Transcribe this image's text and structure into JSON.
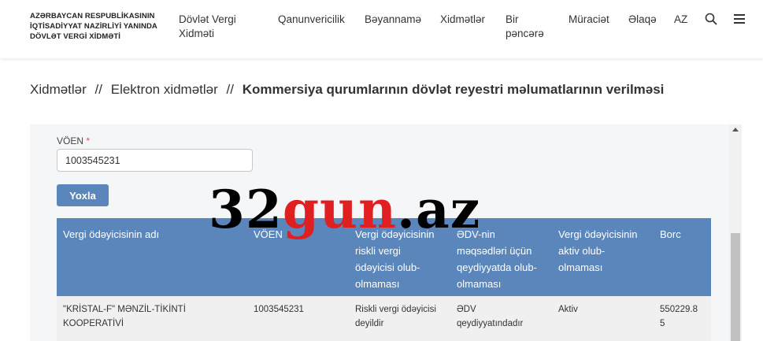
{
  "header": {
    "logo_lines": [
      "AZƏRBAYCAN RESPUBLİKASININ",
      "İQTİSADİYYAT NAZİRLİYİ YANINDA",
      "DÖVLƏT VERGİ XİDMƏTİ"
    ],
    "nav": [
      {
        "label_line1": "Dövlət Vergi",
        "label_line2": "Xidməti"
      },
      {
        "label_line1": "Qanunvericilik"
      },
      {
        "label_line1": "Bəyannamə"
      },
      {
        "label_line1": "Xidmətlər"
      },
      {
        "label_line1": "Bir",
        "label_line2": "pəncərə"
      },
      {
        "label_line1": "Müraciət"
      },
      {
        "label_line1": "Əlaqə"
      },
      {
        "label_line1": "AZ"
      }
    ]
  },
  "breadcrumb": {
    "items": [
      "Xidmətlər",
      "Elektron xidmətlər"
    ],
    "separator": "//",
    "current": "Kommersiya qurumlarının dövlət reyestri məlumatlarının verilməsi"
  },
  "form": {
    "voen_label": "VÖEN",
    "required_mark": "*",
    "voen_value": "1003545231",
    "check_button": "Yoxla"
  },
  "table": {
    "headers": [
      {
        "l1": "Vergi ödəyicisinin adı"
      },
      {
        "l1": "VÖEN"
      },
      {
        "l1": "Vergi ödəyicisinin",
        "l2": "riskli vergi",
        "l3": "ödəyicisi olub-",
        "l4": "olmaması"
      },
      {
        "l1": "ƏDV-nin",
        "l2": "məqsədləri üçün",
        "l3": "qeydiyyatda olub-",
        "l4": "olmaması"
      },
      {
        "l1": "Vergi ödəyicisinin",
        "l2": "aktiv olub-",
        "l3": "olmaması"
      },
      {
        "l1": "Borc"
      }
    ],
    "rows": [
      {
        "name_l1": "\"KRİSTAL-F\" MƏNZİL-TİKİNTİ",
        "name_l2": "KOOPERATİVİ",
        "voen": "1003545231",
        "risk_l1": "Riskli vergi ödəyicisi",
        "risk_l2": "deyildir",
        "vat_l1": "ƏDV",
        "vat_l2": "qeydiyyatındadır",
        "active": "Aktiv",
        "debt_l1": "550229.8",
        "debt_l2": "5"
      }
    ]
  },
  "watermark": {
    "part1": "32",
    "part2": "gun",
    "part3": ".az"
  },
  "colors": {
    "accent": "#5b86bb",
    "watermark_red": "#e02020"
  }
}
